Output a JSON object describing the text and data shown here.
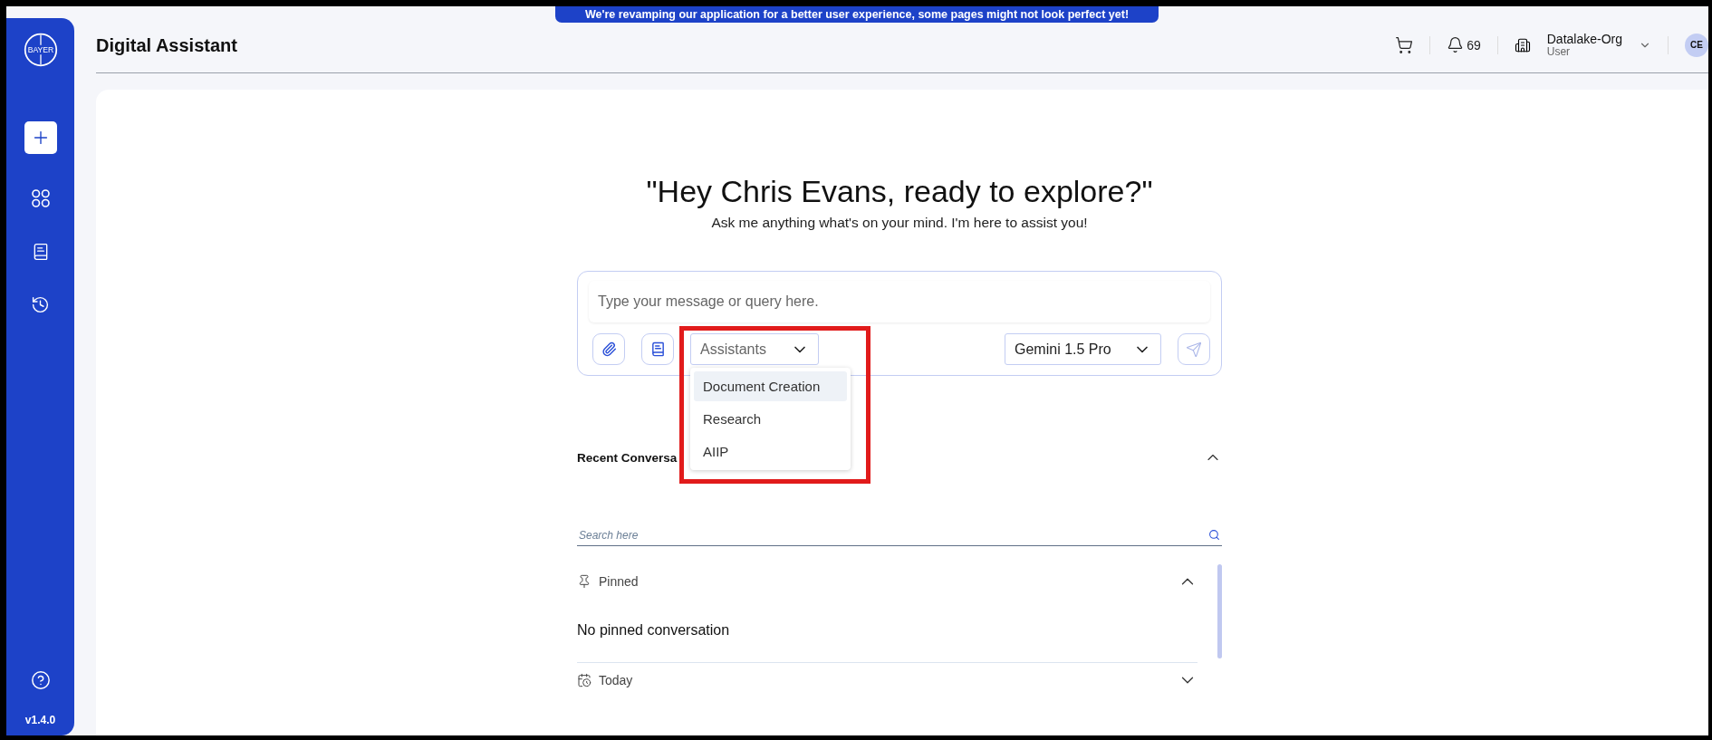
{
  "banner": "We're revamping our application for a better user experience, some pages might not look perfect yet!",
  "sidebar": {
    "logo_text": "BAYER",
    "version": "v1.4.0"
  },
  "header": {
    "title": "Digital Assistant",
    "notifications": "69",
    "org": "Datalake-Org",
    "role": "User",
    "avatar": "CE"
  },
  "greeting": {
    "title": "\"Hey Chris Evans, ready to explore?\"",
    "subtitle": "Ask me anything what's on your mind. I'm here to assist you!"
  },
  "composer": {
    "placeholder": "Type your message or query here.",
    "model": "Gemini 1.5 Pro",
    "assistants": {
      "label": "Assistants",
      "expanded": true,
      "options": [
        {
          "label": "Document Creation",
          "selected": true
        },
        {
          "label": "Research",
          "selected": false
        },
        {
          "label": "AIIP",
          "selected": false
        }
      ]
    }
  },
  "recent": {
    "title": "Recent Conversa",
    "expanded": true,
    "search_placeholder": "Search here",
    "groups": [
      {
        "kind": "pinned",
        "label": "Pinned",
        "expanded": true,
        "empty_text": "No pinned conversation"
      },
      {
        "kind": "today",
        "label": "Today",
        "expanded": false
      }
    ]
  }
}
